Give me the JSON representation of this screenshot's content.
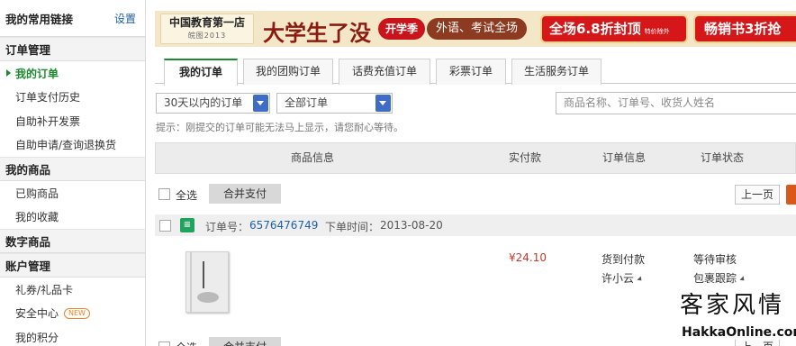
{
  "sidebar": {
    "title": "我的常用链接",
    "settings_link": "设置",
    "sections": [
      {
        "heading": "订单管理",
        "items": [
          "我的订单",
          "订单支付历史",
          "自助补开发票",
          "自助申请/查询退换货"
        ]
      },
      {
        "heading": "我的商品",
        "items": [
          "已购商品",
          "我的收藏"
        ]
      },
      {
        "heading": "数字商品",
        "items": []
      },
      {
        "heading": "账户管理",
        "items": [
          "礼券/礼品卡",
          "安全中心",
          "我的积分"
        ]
      }
    ],
    "new_badge": "NEW",
    "active_item": "我的订单"
  },
  "banner": {
    "logo_line1": "中国教育第一店",
    "logo_line2": "皖图2013",
    "headline": "大学生了没",
    "pill_semester": "开学季",
    "pill_categories": "外语、考试全场",
    "promo1": "全场6.8折封顶",
    "promo1_note": "特价除外",
    "promo2": "畅销书3折抢"
  },
  "tabs": [
    "我的订单",
    "我的团购订单",
    "话费充值订单",
    "彩票订单",
    "生活服务订单"
  ],
  "filters": {
    "time_range": "30天以内的订单",
    "status": "全部订单",
    "search_placeholder": "商品名称、订单号、收货人姓名"
  },
  "tip": "提示：刚提交的订单可能无法马上显示，请您耐心等待。",
  "table_headers": [
    "商品信息",
    "实付款",
    "订单信息",
    "订单状态"
  ],
  "toolbar": {
    "select_all": "全选",
    "merge_pay": "合并支付",
    "prev_page": "上一页"
  },
  "order": {
    "number_label": "订单号：",
    "number": "6576476749",
    "time_label": "下单时间：",
    "time": "2013-08-20",
    "icon_glyph": "≡",
    "price": "¥24.10",
    "payment": "货到付款",
    "recipient": "许小云",
    "status": "等待审核",
    "tracking": "包裹跟踪"
  },
  "watermark": {
    "calligraphy": "客家风情",
    "url": "HakkaOnline.com"
  },
  "colors": {
    "accent_green": "#1b8a2e",
    "price_red": "#c0392b",
    "link_blue": "#1f5fa8",
    "select_arrow_blue": "#3f6cc4"
  }
}
